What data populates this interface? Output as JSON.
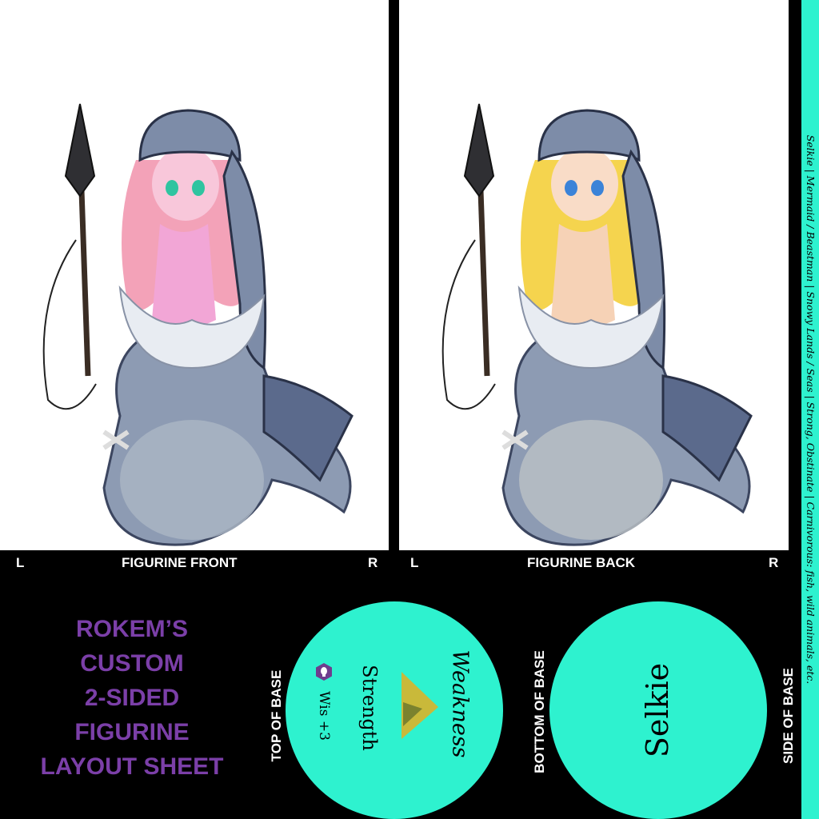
{
  "front": {
    "left_label": "L",
    "title": "FIGURINE FRONT",
    "right_label": "R",
    "hair_color": "#f3a2b8",
    "eye_color": "#2fc4a0",
    "skin_color": "#f2a6d6"
  },
  "back": {
    "left_label": "L",
    "title": "FIGURINE BACK",
    "right_label": "R",
    "hair_color": "#f5d44e",
    "eye_color": "#3b83d8",
    "skin_color": "#f6d2b6"
  },
  "side_strip": {
    "text": "Selkie | Mermaid / Beastman | Snowy Lands / Seas | Strong, Obstinate | Carnivorous: fish, wild animals, etc.",
    "color": "#2ef2cf"
  },
  "layout_title": {
    "line1": "ROKEM’S",
    "line2": "CUSTOM",
    "line3": "2-SIDED",
    "line4": "FIGURINE",
    "line5": "LAYOUT SHEET",
    "color": "#7b3fa8"
  },
  "labels": {
    "top_of_base": "TOP OF BASE",
    "bottom_of_base": "BOTTOM OF BASE",
    "side_of_base": "SIDE OF BASE"
  },
  "base_top": {
    "weakness": "Weakness",
    "strength": "Strength",
    "stat": "Wis +3",
    "icon": "wisdom-hexagon-icon",
    "color": "#2ef2cf"
  },
  "base_bottom": {
    "name": "Selkie"
  }
}
